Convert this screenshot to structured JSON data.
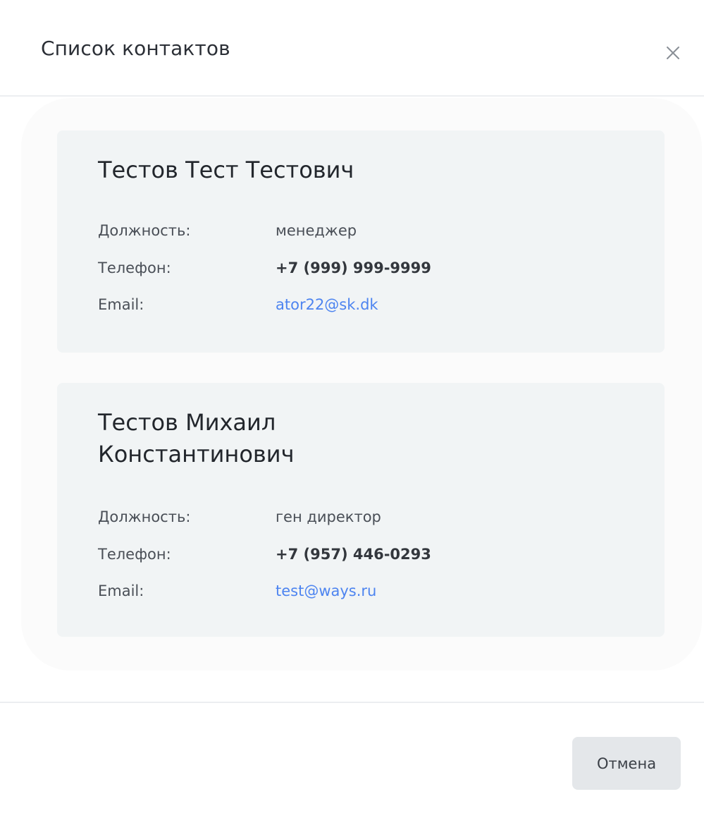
{
  "dialog": {
    "title": "Список контактов",
    "close_icon": "close-icon"
  },
  "contacts": [
    {
      "name": "Тестов Тест Тестович",
      "position_label": "Должность:",
      "position": "менеджер",
      "phone_label": "Телефон:",
      "phone": "+7 (999) 999-9999",
      "email_label": "Email:",
      "email": "ator22@sk.dk"
    },
    {
      "name": "Тестов Михаил Константинович",
      "position_label": "Должность:",
      "position": "ген директор",
      "phone_label": "Телефон:",
      "phone": "+7 (957) 446-0293",
      "email_label": "Email:",
      "email": "test@ways.ru"
    }
  ],
  "footer": {
    "cancel_label": "Отмена"
  },
  "colors": {
    "card_background": "#f1f4f5",
    "email_link": "#4d84f0",
    "cancel_button": "#e4e7ea"
  }
}
